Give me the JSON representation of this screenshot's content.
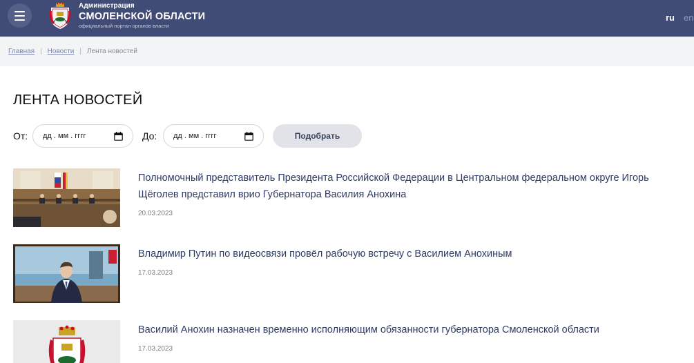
{
  "header": {
    "brand_line1": "Администрация",
    "brand_line2": "СМОЛЕНСКОЙ ОБЛАСТИ",
    "brand_line3": "официальный портал органов власти",
    "lang_ru": "ru",
    "lang_en": "en",
    "bg_color": "#414c76"
  },
  "breadcrumbs": {
    "home": "Главная",
    "news": "Новости",
    "current": "Лента новостей"
  },
  "page": {
    "title": "ЛЕНТА НОВОСТЕЙ"
  },
  "filter": {
    "from_label": "От:",
    "to_label": "До:",
    "from_placeholder": "дд . мм . гггг",
    "to_placeholder": "дд . мм . гггг",
    "submit_label": "Подобрать"
  },
  "news": [
    {
      "title": "Полномочный представитель Президента Российской Федерации в Центральном федеральном округе Игорь Щёголев представил врио Губернатора Василия Анохина",
      "date": "20.03.2023",
      "image": "meeting-hall-photo"
    },
    {
      "title": "Владимир Путин по видеосвязи провёл рабочую встречу с Василием Анохиным",
      "date": "17.03.2023",
      "image": "video-call-photo"
    },
    {
      "title": "Василий Анохин назначен временно исполняющим обязанности губернатора Смоленской области",
      "date": "17.03.2023",
      "image": "coat-of-arms"
    }
  ]
}
